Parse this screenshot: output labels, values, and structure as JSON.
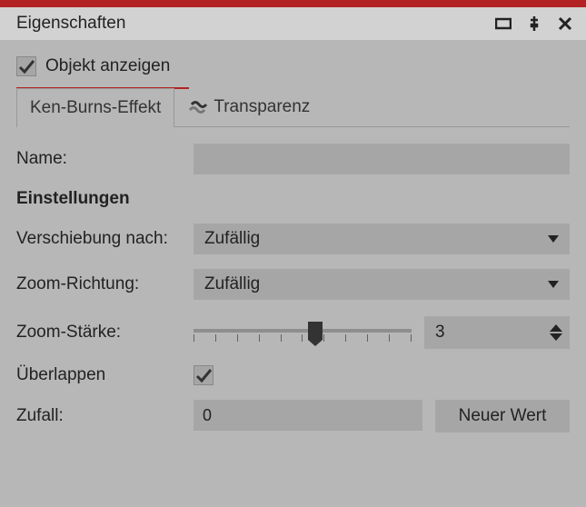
{
  "header": {
    "title": "Eigenschaften"
  },
  "show": {
    "label": "Objekt anzeigen",
    "checked": true
  },
  "tabs": {
    "items": [
      {
        "label": "Ken-Burns-Effekt"
      },
      {
        "label": "Transparenz"
      }
    ]
  },
  "form": {
    "name_label": "Name:",
    "name_value": "",
    "settings_label": "Einstellungen",
    "shift_label": "Verschiebung nach:",
    "shift_value": "Zufällig",
    "zoomdir_label": "Zoom-Richtung:",
    "zoomdir_value": "Zufällig",
    "zoomstr_label": "Zoom-Stärke:",
    "zoomstr_value": "3",
    "overlap_label": "Überlappen",
    "overlap_checked": true,
    "random_label": "Zufall:",
    "random_value": "0",
    "newvalue_btn": "Neuer Wert"
  }
}
